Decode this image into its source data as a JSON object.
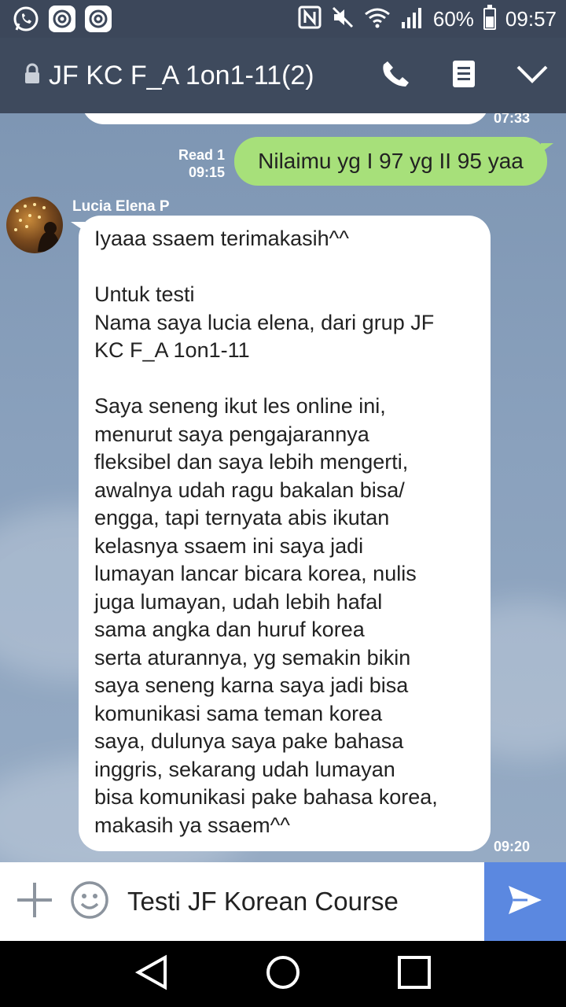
{
  "status_bar": {
    "battery_percent": "60%",
    "time": "09:57",
    "icons": [
      "whatsapp-icon",
      "email-at-icon",
      "email-at-icon",
      "nfc-icon",
      "mute-icon",
      "wifi-icon",
      "signal-icon",
      "battery-icon"
    ]
  },
  "header": {
    "title": "JF KC F_A 1on1-11(2)",
    "icons": [
      "lock-icon",
      "phone-icon",
      "notes-icon",
      "chevron-down-icon"
    ]
  },
  "chat": {
    "previous_time": "07:33",
    "outgoing": {
      "read_label": "Read 1",
      "time": "09:15",
      "text": "Nilaimu yg I 97 yg II 95 yaa",
      "bubble_color": "#a7e07a"
    },
    "incoming": {
      "sender": "Lucia Elena P",
      "time": "09:20",
      "lines": [
        "Iyaaa ssaem terimakasih^^",
        "",
        "Untuk testi",
        "Nama saya lucia elena, dari grup JF",
        "KC F_A 1on1-11",
        "",
        "Saya seneng ikut les online ini,",
        "menurut saya pengajarannya",
        "fleksibel dan saya lebih mengerti,",
        "awalnya udah ragu bakalan bisa/",
        "engga, tapi ternyata abis ikutan",
        "kelasnya ssaem ini saya jadi",
        "lumayan lancar bicara korea, nulis",
        "juga lumayan, udah lebih hafal",
        "sama angka dan huruf korea",
        "serta aturannya, yg semakin bikin",
        "saya seneng karna saya jadi bisa",
        "komunikasi sama teman korea",
        "saya, dulunya saya pake bahasa",
        "inggris, sekarang udah lumayan",
        "bisa komunikasi pake bahasa korea,",
        "makasih ya ssaem^^"
      ]
    }
  },
  "input": {
    "value": "Testi JF Korean Course",
    "send_color": "#5b88e0"
  },
  "nav": {
    "icons": [
      "back-icon",
      "home-icon",
      "recents-icon"
    ]
  }
}
